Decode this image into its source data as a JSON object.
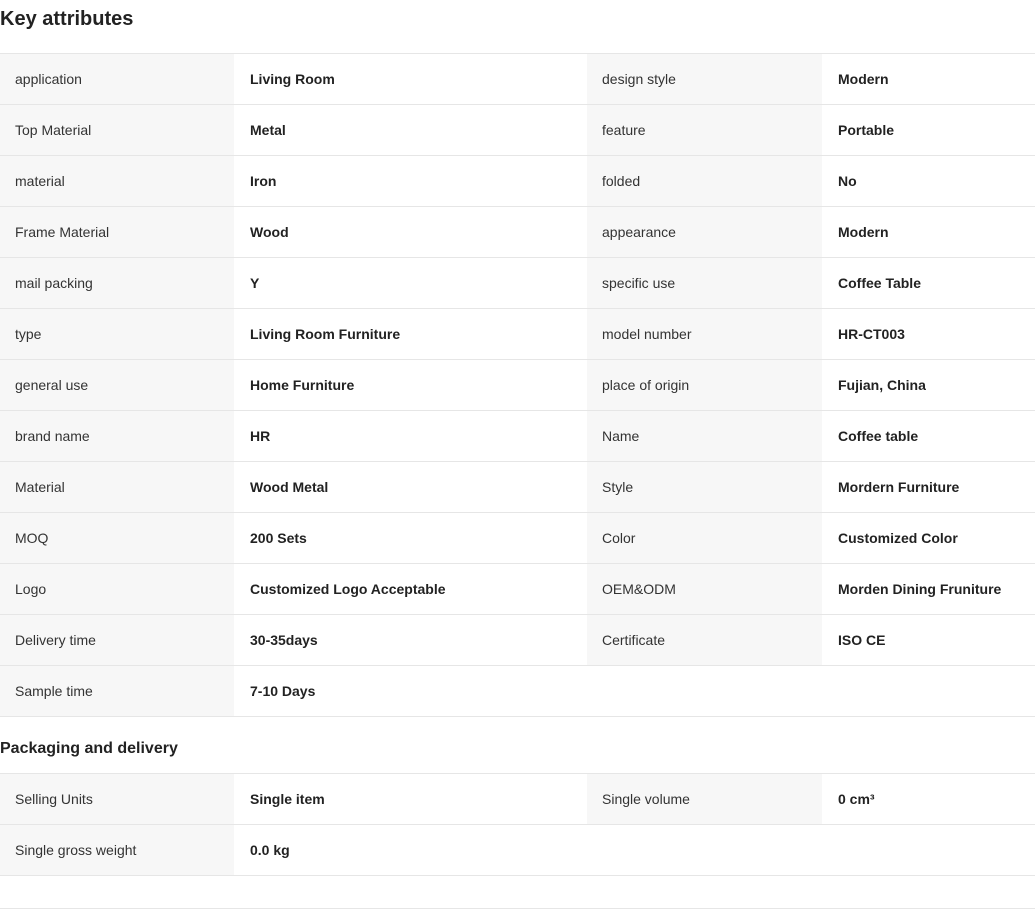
{
  "key_attributes": {
    "title": "Key attributes",
    "rows": [
      {
        "name1": "application",
        "value1": "Living Room",
        "name2": "design style",
        "value2": "Modern"
      },
      {
        "name1": "Top Material",
        "value1": "Metal",
        "name2": "feature",
        "value2": "Portable"
      },
      {
        "name1": "material",
        "value1": "Iron",
        "name2": "folded",
        "value2": "No"
      },
      {
        "name1": "Frame Material",
        "value1": "Wood",
        "name2": "appearance",
        "value2": "Modern"
      },
      {
        "name1": "mail packing",
        "value1": "Y",
        "name2": "specific use",
        "value2": "Coffee Table"
      },
      {
        "name1": "type",
        "value1": "Living Room Furniture",
        "name2": "model number",
        "value2": "HR-CT003"
      },
      {
        "name1": "general use",
        "value1": "Home Furniture",
        "name2": "place of origin",
        "value2": "Fujian, China"
      },
      {
        "name1": "brand name",
        "value1": "HR",
        "name2": "Name",
        "value2": "Coffee table"
      },
      {
        "name1": "Material",
        "value1": "Wood Metal",
        "name2": "Style",
        "value2": "Mordern Furniture"
      },
      {
        "name1": "MOQ",
        "value1": "200 Sets",
        "name2": "Color",
        "value2": "Customized Color"
      },
      {
        "name1": "Logo",
        "value1": "Customized Logo Acceptable",
        "name2": "OEM&ODM",
        "value2": "Morden Dining Fruniture"
      },
      {
        "name1": "Delivery time",
        "value1": "30-35days",
        "name2": "Certificate",
        "value2": "ISO CE"
      },
      {
        "name1": "Sample time",
        "value1": "7-10 Days",
        "name2": "",
        "value2": ""
      }
    ]
  },
  "packaging_delivery": {
    "title": "Packaging and delivery",
    "rows": [
      {
        "name1": "Selling Units",
        "value1": "Single item",
        "name2": "Single volume",
        "value2": "0 cm³"
      },
      {
        "name1": "Single gross weight",
        "value1": "0.0 kg",
        "name2": "",
        "value2": ""
      }
    ]
  }
}
